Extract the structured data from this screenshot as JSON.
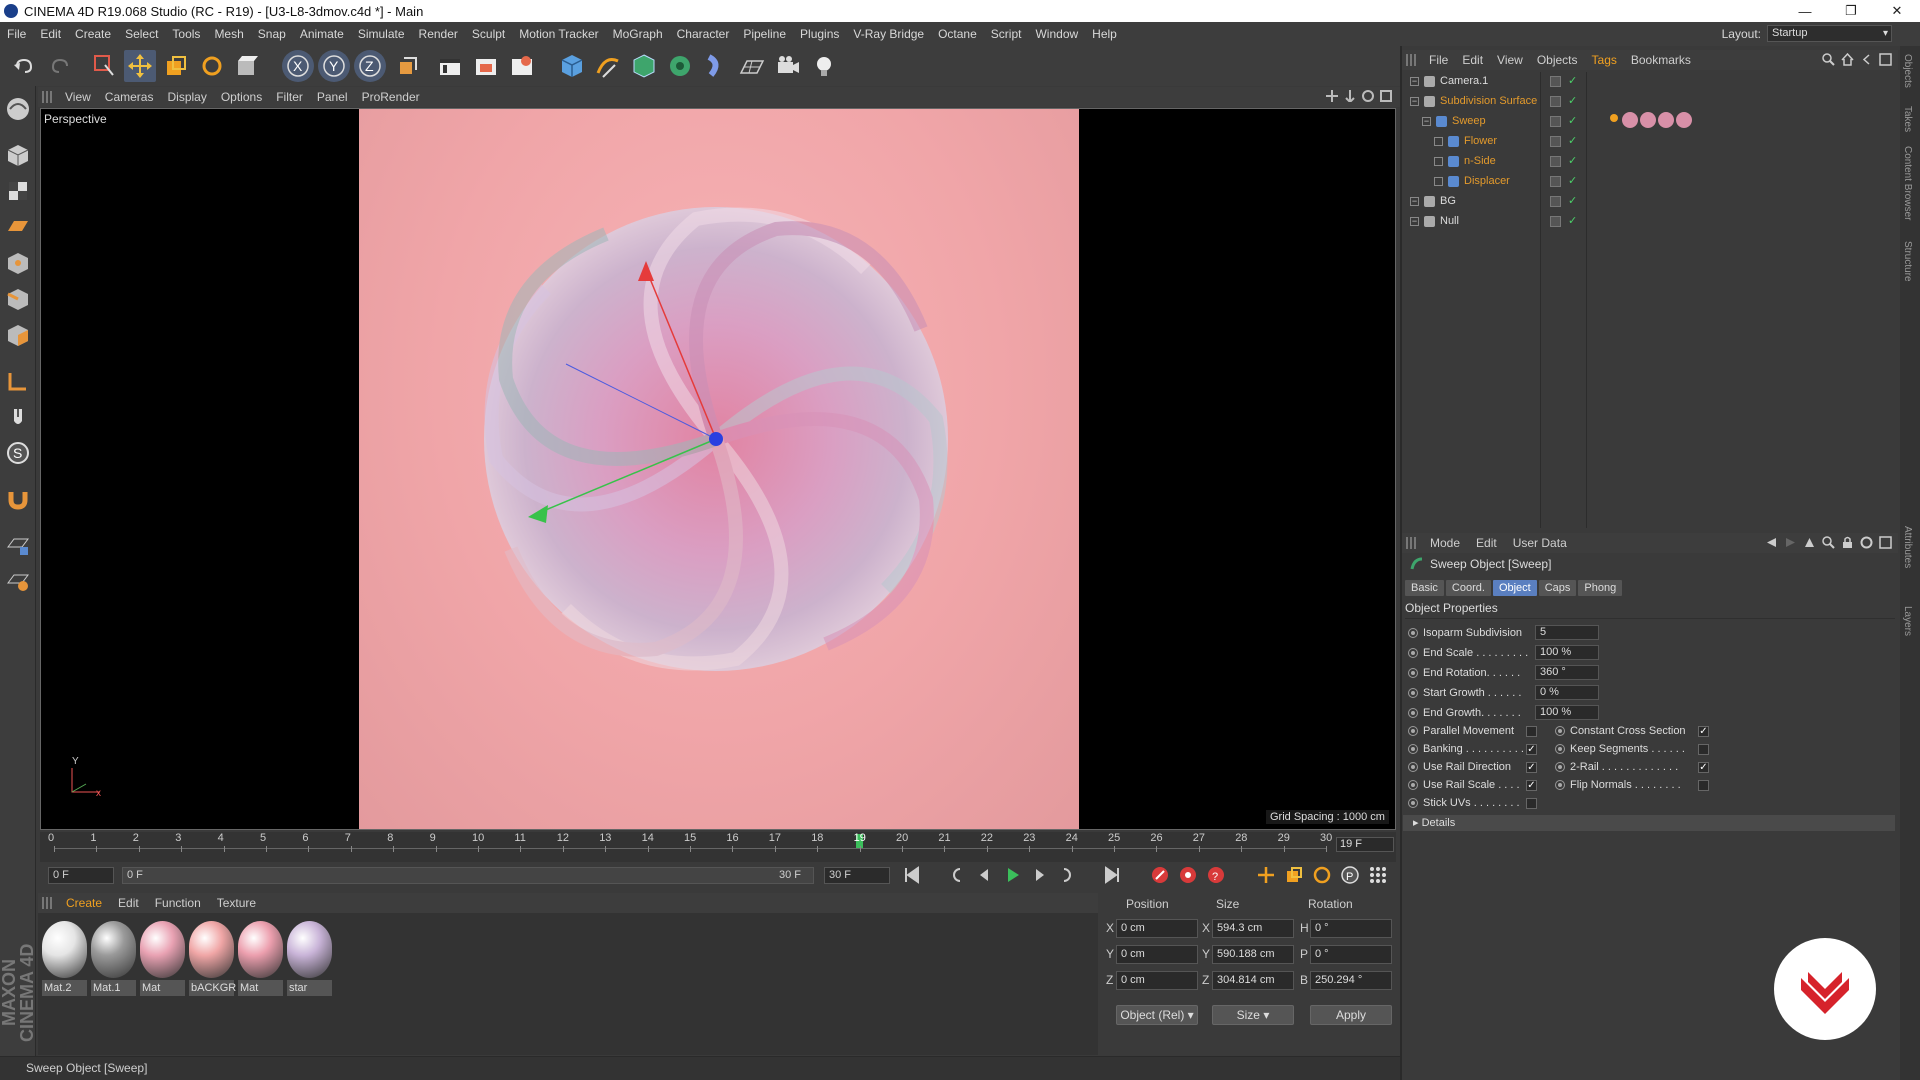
{
  "window": {
    "title": "CINEMA 4D R19.068 Studio (RC - R19) - [U3-L8-3dmov.c4d *] - Main"
  },
  "menu": [
    "File",
    "Edit",
    "Create",
    "Select",
    "Tools",
    "Mesh",
    "Snap",
    "Animate",
    "Simulate",
    "Render",
    "Sculpt",
    "Motion Tracker",
    "MoGraph",
    "Character",
    "Pipeline",
    "Plugins",
    "V-Ray Bridge",
    "Octane",
    "Script",
    "Window",
    "Help"
  ],
  "layout": {
    "label": "Layout:",
    "value": "Startup"
  },
  "viewport": {
    "menu": [
      "View",
      "Cameras",
      "Display",
      "Options",
      "Filter",
      "Panel",
      "ProRender"
    ],
    "label": "Perspective",
    "grid_spacing": "Grid Spacing : 1000 cm",
    "axis_y": "Y",
    "axis_x": "x"
  },
  "timeline": {
    "ticks": [
      "0",
      "1",
      "2",
      "3",
      "4",
      "5",
      "6",
      "7",
      "8",
      "9",
      "10",
      "11",
      "12",
      "13",
      "14",
      "15",
      "16",
      "17",
      "18",
      "19",
      "20",
      "21",
      "22",
      "23",
      "24",
      "25",
      "26",
      "27",
      "28",
      "29",
      "30"
    ],
    "current_label": "19",
    "current_frame": "19 F",
    "start_field": "0 F",
    "range_start": "0 F",
    "range_end": "30 F",
    "end_field": "30 F",
    "current_fraction": 0.633
  },
  "material_manager": {
    "menu": [
      "Create",
      "Edit",
      "Function",
      "Texture"
    ],
    "materials": [
      {
        "name": "Mat.2",
        "color": "#e5e5e5"
      },
      {
        "name": "Mat.1",
        "color": "#9a9a9a"
      },
      {
        "name": "Mat",
        "color": "#e9a2b3"
      },
      {
        "name": "bACKGR",
        "color": "#f0a6a6"
      },
      {
        "name": "Mat",
        "color": "#ec9fae"
      },
      {
        "name": "star",
        "color": "#c9b4d8"
      }
    ]
  },
  "coordinates": {
    "headers": [
      "Position",
      "Size",
      "Rotation"
    ],
    "rows": [
      {
        "axis": "X",
        "pos": "0 cm",
        "saxis": "X",
        "size": "594.3 cm",
        "raxis": "H",
        "rot": "0 °"
      },
      {
        "axis": "Y",
        "pos": "0 cm",
        "saxis": "Y",
        "size": "590.188 cm",
        "raxis": "P",
        "rot": "0 °"
      },
      {
        "axis": "Z",
        "pos": "0 cm",
        "saxis": "Z",
        "size": "304.814 cm",
        "raxis": "B",
        "rot": "250.294 °"
      }
    ],
    "mode": "Object (Rel)",
    "size_mode": "Size",
    "apply": "Apply"
  },
  "status": "Sweep Object [Sweep]",
  "object_manager": {
    "menu": [
      "File",
      "Edit",
      "View",
      "Objects",
      "Tags",
      "Bookmarks"
    ],
    "objects": [
      {
        "name": "Camera.1",
        "color": "#dcdcdc",
        "indent": 0
      },
      {
        "name": "Subdivision Surface",
        "color": "#e39a2c",
        "indent": 0
      },
      {
        "name": "Sweep",
        "color": "#e39a2c",
        "indent": 1
      },
      {
        "name": "Flower",
        "color": "#e39a2c",
        "indent": 2
      },
      {
        "name": "n-Side",
        "color": "#e39a2c",
        "indent": 2
      },
      {
        "name": "Displacer",
        "color": "#e39a2c",
        "indent": 2
      },
      {
        "name": "BG",
        "color": "#dcdcdc",
        "indent": 0
      },
      {
        "name": "Null",
        "color": "#dcdcdc",
        "indent": 0
      }
    ]
  },
  "attributes": {
    "menu": [
      "Mode",
      "Edit",
      "User Data"
    ],
    "title": "Sweep Object [Sweep]",
    "tabs": [
      "Basic",
      "Coord.",
      "Object",
      "Caps",
      "Phong"
    ],
    "active_tab": "Object",
    "section": "Object Properties",
    "fields": [
      {
        "label": "Isoparm Subdivision",
        "value": "5"
      },
      {
        "label": "End Scale . . . . . . . . .",
        "value": "100 %"
      },
      {
        "label": "End Rotation. . . . . .",
        "value": "360 °"
      },
      {
        "label": "Start Growth . . . . . .",
        "value": "0 %"
      },
      {
        "label": "End Growth. . . . . . .",
        "value": "100 %"
      }
    ],
    "checks_left": [
      {
        "label": "Parallel Movement",
        "checked": false
      },
      {
        "label": "Banking . . . . . . . . . .",
        "checked": true
      },
      {
        "label": "Use Rail Direction",
        "checked": true
      },
      {
        "label": "Use Rail Scale . . . .",
        "checked": true
      },
      {
        "label": "Stick UVs . . . . . . . .",
        "checked": false
      }
    ],
    "checks_right": [
      {
        "label": "Constant Cross Section",
        "checked": true
      },
      {
        "label": "Keep Segments . . . . . .",
        "checked": false
      },
      {
        "label": "2-Rail . . . . . . . . . . . . .",
        "checked": true
      },
      {
        "label": "Flip Normals . . . . . . . .",
        "checked": false
      }
    ],
    "details": "Details"
  },
  "side_tabs": [
    "Objects",
    "Takes",
    "Content Browser",
    "Structure",
    "Attributes",
    "Layers"
  ],
  "maxon": "MAXON CINEMA 4D"
}
